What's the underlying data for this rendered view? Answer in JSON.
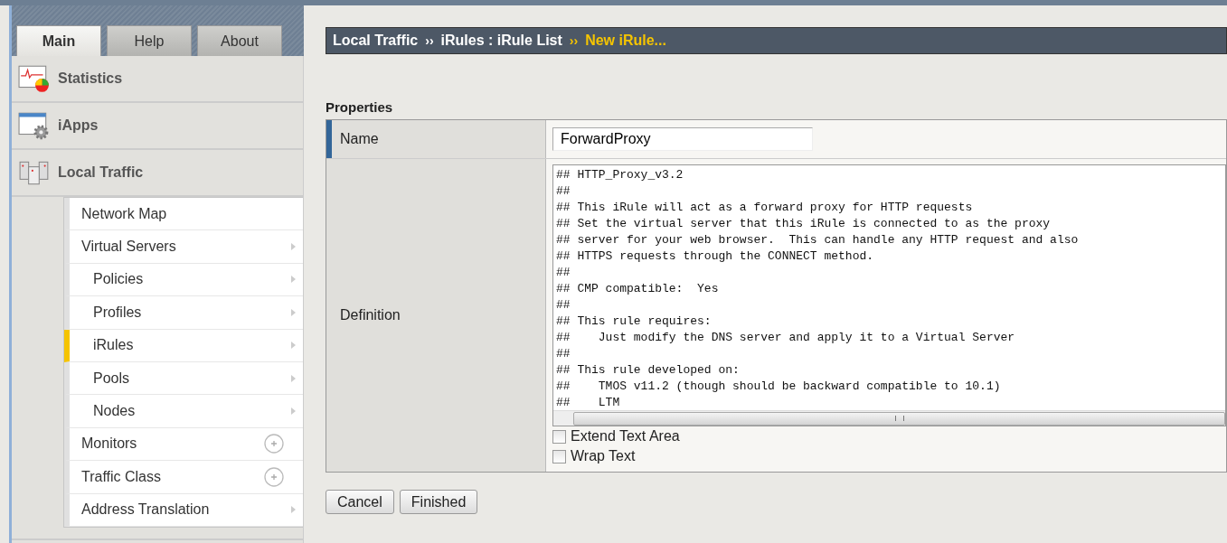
{
  "tabs": [
    {
      "label": "Main",
      "selected": true
    },
    {
      "label": "Help",
      "selected": false
    },
    {
      "label": "About",
      "selected": false
    }
  ],
  "sidebar": {
    "sections": [
      {
        "label": "Statistics",
        "kind": "chart"
      },
      {
        "label": "iApps",
        "kind": "gear"
      },
      {
        "label": "Local Traffic",
        "kind": "servers",
        "items": [
          {
            "label": "Network Map",
            "kind": "none",
            "selected": false
          },
          {
            "label": "Virtual Servers",
            "kind": "arrow",
            "selected": false,
            "children": [
              {
                "label": "Policies",
                "kind": "arrow",
                "selected": false
              },
              {
                "label": "Profiles",
                "kind": "arrow",
                "selected": false
              },
              {
                "label": "iRules",
                "kind": "arrow",
                "selected": true
              },
              {
                "label": "Pools",
                "kind": "arrow",
                "selected": false
              },
              {
                "label": "Nodes",
                "kind": "arrow",
                "selected": false
              }
            ]
          },
          {
            "label": "Monitors",
            "kind": "plus",
            "selected": false
          },
          {
            "label": "Traffic Class",
            "kind": "plus",
            "selected": false
          },
          {
            "label": "Address Translation",
            "kind": "arrow",
            "selected": false
          }
        ]
      }
    ]
  },
  "breadcrumb": [
    {
      "label": "Local Traffic",
      "current": false
    },
    {
      "separator": "››",
      "label": "iRules : iRule List",
      "current": false
    },
    {
      "separator": "››",
      "label": "New iRule...",
      "current": true
    }
  ],
  "section_title": "Properties",
  "form": {
    "name_label": "Name",
    "name_value": "ForwardProxy",
    "definition_label": "Definition",
    "definition_lines": [
      "## HTTP_Proxy_v3.2",
      "##",
      "## This iRule will act as a forward proxy for HTTP requests",
      "## Set the virtual server that this iRule is connected to as the proxy",
      "## server for your web browser.  This can handle any HTTP request and also",
      "## HTTPS requests through the CONNECT method.",
      "##",
      "## CMP compatible:  Yes",
      "##",
      "## This rule requires:",
      "##    Just modify the DNS server and apply it to a Virtual Server",
      "##",
      "## This rule developed on:",
      "##    TMOS v11.2 (though should be backward compatible to 10.1)",
      "##    LTM"
    ],
    "options": [
      {
        "label": "Extend Text Area",
        "checked": false
      },
      {
        "label": "Wrap Text",
        "checked": false
      }
    ]
  },
  "buttons": [
    "Cancel",
    "Finished"
  ]
}
